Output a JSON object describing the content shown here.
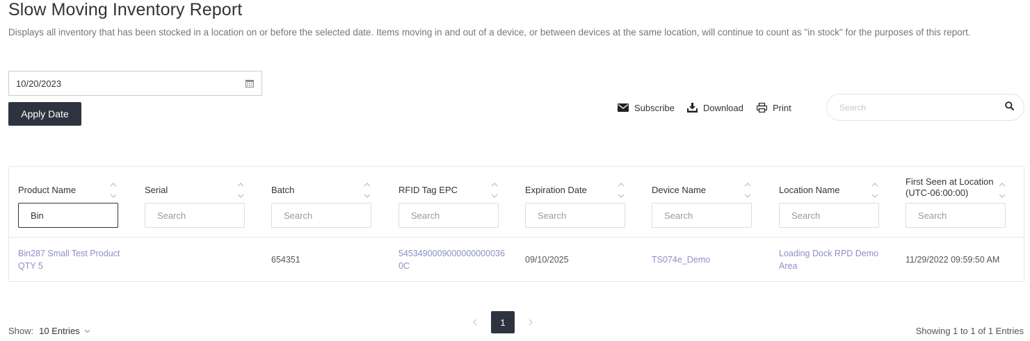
{
  "page": {
    "title": "Slow Moving Inventory Report",
    "description": "Displays all inventory that has been stocked in a location on or before the selected date. Items moving in and out of a device, or between devices at the same location, will continue to count as \"in stock\" for the purposes of this report."
  },
  "date_filter": {
    "value": "10/20/2023",
    "icon": "calendar-icon",
    "apply_label": "Apply Date"
  },
  "toolbar": {
    "subscribe_label": "Subscribe",
    "download_label": "Download",
    "print_label": "Print",
    "search_placeholder": "Search"
  },
  "table": {
    "columns": [
      {
        "label": "Product Name",
        "filter_value": "Bin",
        "placeholder": "Search"
      },
      {
        "label": "Serial",
        "filter_value": "",
        "placeholder": "Search"
      },
      {
        "label": "Batch",
        "filter_value": "",
        "placeholder": "Search"
      },
      {
        "label": "RFID Tag EPC",
        "filter_value": "",
        "placeholder": "Search"
      },
      {
        "label": "Expiration Date",
        "filter_value": "",
        "placeholder": "Search"
      },
      {
        "label": "Device Name",
        "filter_value": "",
        "placeholder": "Search"
      },
      {
        "label": "Location Name",
        "filter_value": "",
        "placeholder": "Search"
      },
      {
        "label": "First Seen at Location",
        "label_line2": "(UTC-06:00:00)",
        "filter_value": "",
        "placeholder": "Search"
      }
    ],
    "rows": [
      {
        "product_name_line1": "Bin287 Small Test Product",
        "product_name_line2": "QTY 5",
        "serial": "",
        "batch": "654351",
        "rfid_line1": "5453490009000000000036",
        "rfid_line2": "0C",
        "expiration_date": "09/10/2025",
        "device_name": "TS074e_Demo",
        "location_line1": "Loading Dock RPD Demo",
        "location_line2": "Area",
        "first_seen": "11/29/2022 09:59:50 AM"
      }
    ]
  },
  "footer": {
    "show_label": "Show:",
    "entries_value": "10 Entries",
    "current_page": "1",
    "showing_text": "Showing 1 to 1 of 1 Entries"
  },
  "colors": {
    "accent_dark": "#2d3440",
    "link": "#8b8fc7"
  }
}
